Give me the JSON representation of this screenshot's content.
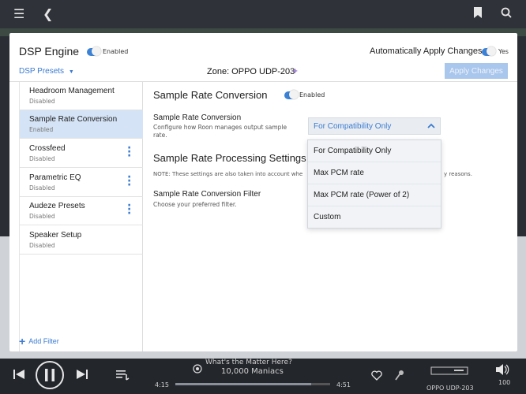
{
  "dialog": {
    "title": "DSP Engine",
    "enabled_label": "Enabled",
    "auto_apply_label": "Automatically Apply Changes",
    "auto_apply_value": "Yes",
    "presets_label": "DSP Presets",
    "presets_arrow": "▼",
    "zone_label": "Zone: OPPO UDP-203",
    "apply_button": "Apply Changes"
  },
  "sidebar": {
    "items": [
      {
        "label": "Headroom Management",
        "status": "Disabled"
      },
      {
        "label": "Sample Rate Conversion",
        "status": "Enabled"
      },
      {
        "label": "Crossfeed",
        "status": "Disabled"
      },
      {
        "label": "Parametric EQ",
        "status": "Disabled"
      },
      {
        "label": "Audeze Presets",
        "status": "Disabled"
      },
      {
        "label": "Speaker Setup",
        "status": "Disabled"
      }
    ],
    "add_filter": "Add Filter"
  },
  "main": {
    "title": "Sample Rate Conversion",
    "enabled_label": "Enabled",
    "src_label": "Sample Rate Conversion",
    "src_desc": "Configure how Roon manages output sample rate.",
    "select_value": "For Compatibility Only",
    "section_title": "Sample Rate Processing Settings",
    "note_start": "NOTE: These settings are also taken into account whe",
    "note_end": "y reasons.",
    "filter_label": "Sample Rate Conversion Filter",
    "filter_desc": "Choose your preferred filter.",
    "options": [
      "For Compatibility Only",
      "Max PCM rate",
      "Max PCM rate (Power of 2)",
      "Custom"
    ]
  },
  "player": {
    "track": "What's the Matter Here?",
    "artist": "10,000 Maniacs",
    "elapsed": "4:15",
    "total": "4:51",
    "zone": "OPPO UDP-203",
    "volume": "100",
    "progress": 0.876
  },
  "colors": {
    "accent": "#3b7bd0",
    "active_row": "#d4e3f5"
  }
}
